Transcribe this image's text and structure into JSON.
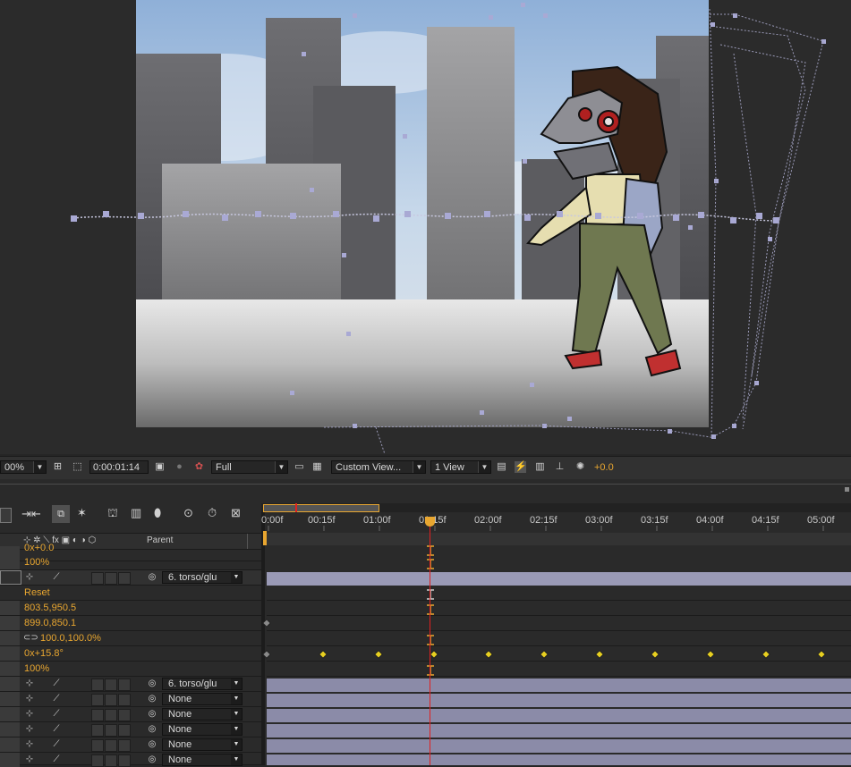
{
  "viewer_toolbar": {
    "zoom": "00%",
    "timecode": "0:00:01:14",
    "resolution": "Full",
    "view": "Custom View...",
    "layout": "1 View",
    "exposure": "+0.0"
  },
  "timeline": {
    "parent_header": "Parent",
    "ruler": [
      "0:00f",
      "00:15f",
      "01:00f",
      "01:15f",
      "02:00f",
      "02:15f",
      "03:00f",
      "03:15f",
      "04:00f",
      "04:15f",
      "05:00f"
    ],
    "rows": {
      "clipped_value": "0x+0.0",
      "opacity_1": "100%",
      "parent_1": "6. torso/glu",
      "reset": "Reset",
      "anchor": "803.5,950.5",
      "position": "899.0,850.1",
      "scale": "100.0,100.0%",
      "rotation": "0x+15.8°",
      "opacity_2": "100%",
      "parent_2": "6. torso/glu",
      "parent_3": "None",
      "parent_4": "None",
      "parent_5": "None",
      "parent_6": "None",
      "parent_7": "None"
    }
  },
  "colors": {
    "accent": "#e8a630",
    "playhead": "#e02020",
    "layer_bar": "#8b8ba8",
    "keyframe": "#e8d020"
  }
}
